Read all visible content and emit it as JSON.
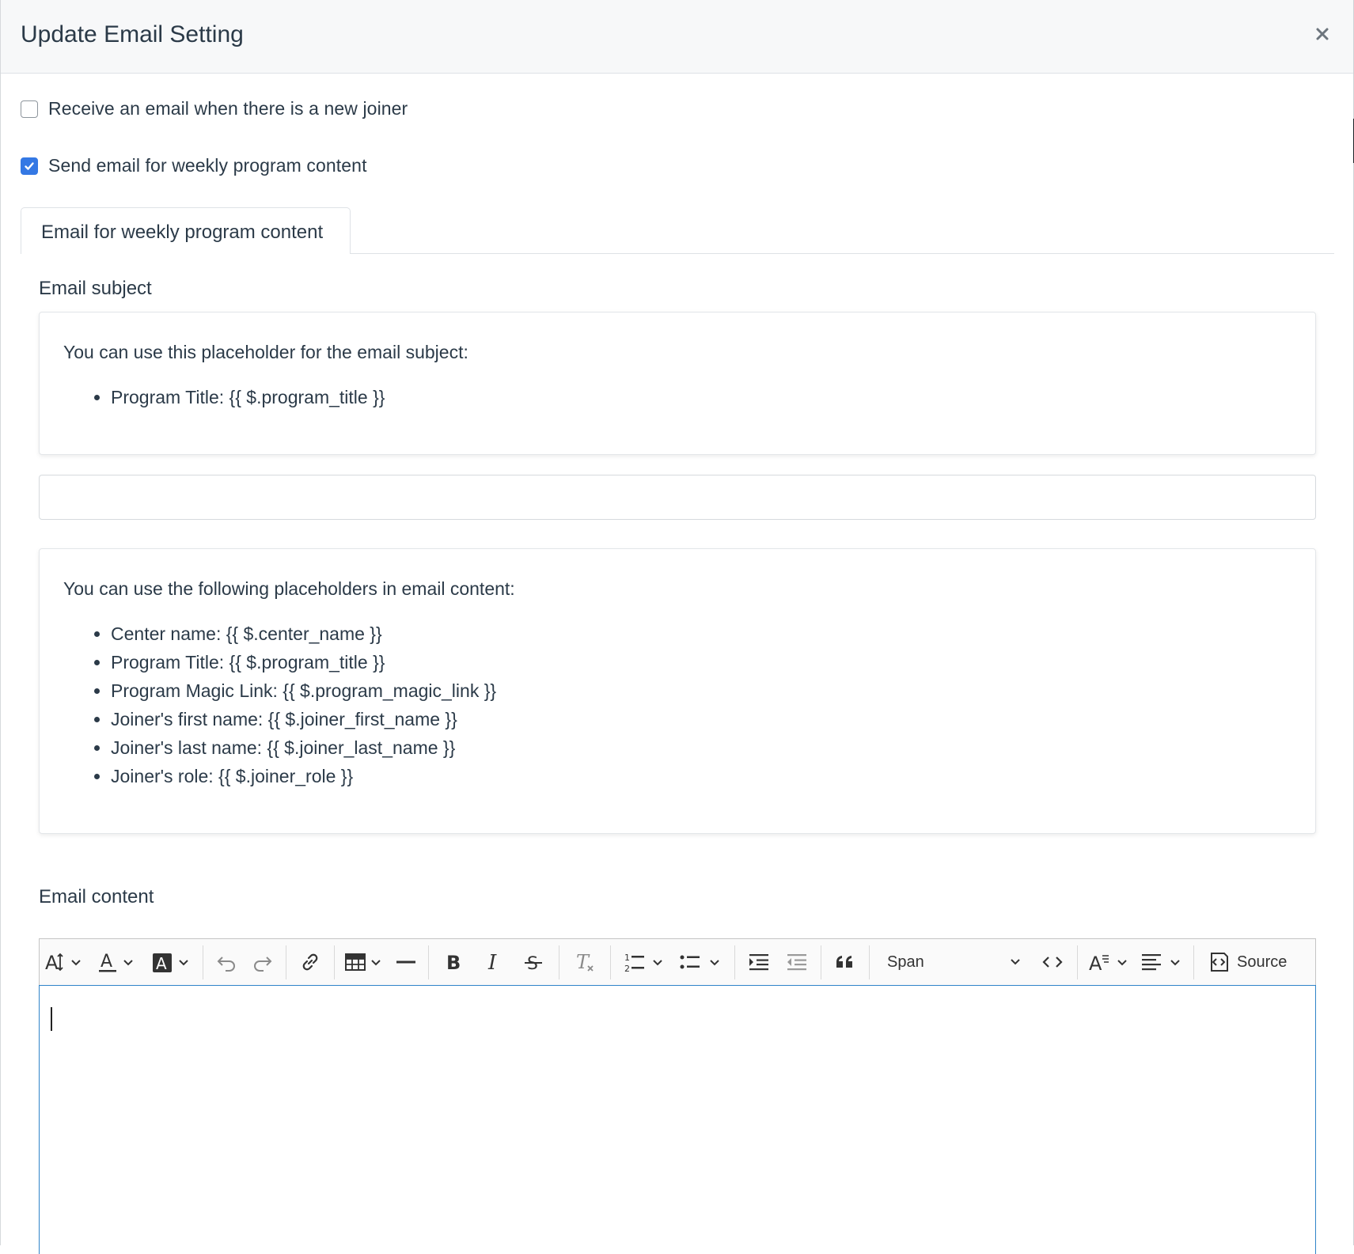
{
  "modal": {
    "title": "Update Email Setting",
    "close_label": "×"
  },
  "settings": {
    "new_joiner": {
      "label": "Receive an email when there is a new joiner",
      "checked": false
    },
    "weekly_content": {
      "label": "Send email for weekly program content",
      "checked": true
    }
  },
  "tabs": [
    {
      "label": "Email for weekly program content",
      "active": true
    }
  ],
  "subject": {
    "label": "Email subject",
    "help_intro": "You can use this placeholder for the email subject:",
    "placeholders": [
      "Program Title: {{ $.program_title }}"
    ],
    "value": ""
  },
  "content": {
    "help_intro": "You can use the following placeholders in email content:",
    "placeholders": [
      "Center name: {{ $.center_name }}",
      "Program Title: {{ $.program_title }}",
      "Program Magic Link: {{ $.program_magic_link }}",
      "Joiner's first name: {{ $.joiner_first_name }}",
      "Joiner's last name: {{ $.joiner_last_name }}",
      "Joiner's role: {{ $.joiner_role }}"
    ],
    "label": "Email content"
  },
  "editor": {
    "toolbar_icons": [
      "font-size-icon",
      "font-color-icon",
      "font-background-color-icon",
      "undo-icon",
      "redo-icon",
      "link-icon",
      "table-icon",
      "horizontal-line-icon",
      "bold-icon",
      "italic-icon",
      "strikethrough-icon",
      "remove-format-icon",
      "numbered-list-icon",
      "bulleted-list-icon",
      "indent-icon",
      "outdent-icon",
      "block-quote-icon",
      "code-icon",
      "font-family-icon",
      "alignment-icon",
      "source-icon"
    ],
    "style_select_value": "Span",
    "source_label": "Source",
    "body": ""
  },
  "colors": {
    "accent": "#3478e4",
    "editor_focus_border": "#2f84c9",
    "text": "#2b3a48"
  }
}
